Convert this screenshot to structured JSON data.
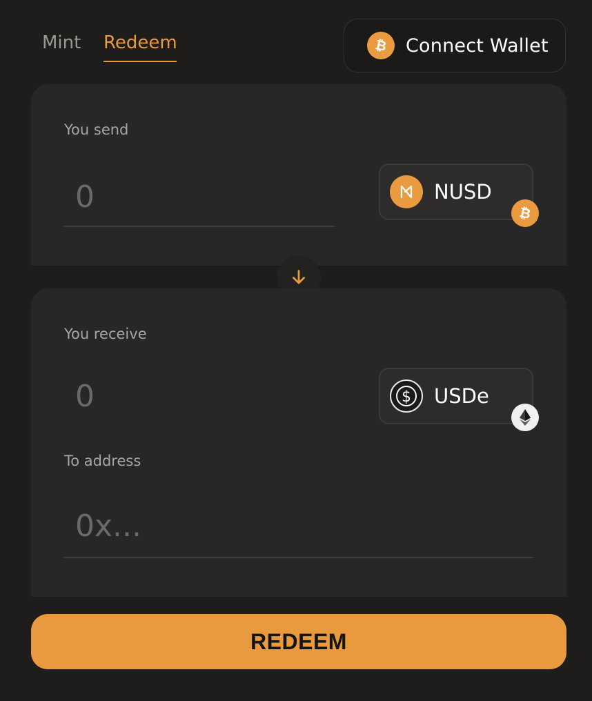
{
  "tabs": [
    {
      "label": "Mint",
      "active": false
    },
    {
      "label": "Redeem",
      "active": true
    }
  ],
  "header": {
    "connect_wallet_label": "Connect Wallet",
    "wallet_icon": "bitcoin-icon"
  },
  "send": {
    "label": "You send",
    "amount_placeholder": "0",
    "amount_value": "",
    "token": {
      "symbol": "NUSD",
      "icon": "nusd-icon",
      "chain_icon": "bitcoin-icon"
    }
  },
  "swap_direction_icon": "arrow-down-icon",
  "receive": {
    "label": "You receive",
    "amount_placeholder": "0",
    "amount_value": "",
    "token": {
      "symbol": "USDe",
      "icon": "usde-icon",
      "chain_icon": "ethereum-icon"
    }
  },
  "to_address": {
    "label": "To address",
    "placeholder": "0x...",
    "value": ""
  },
  "action": {
    "label": "REDEEM"
  },
  "colors": {
    "background": "#1e1d1c",
    "panel": "#272727",
    "accent": "#e99a3e",
    "inactive_tab": "#9b9893"
  }
}
